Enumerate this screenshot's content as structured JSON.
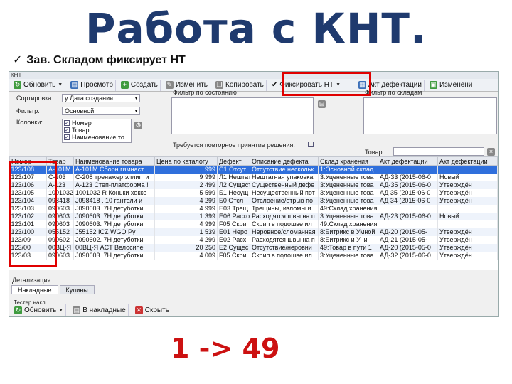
{
  "slide": {
    "title": "Работа с КНТ.",
    "bullet": "Зав. Складом фиксирует НТ",
    "counter": "1 -> 49"
  },
  "window": {
    "title": "КНТ"
  },
  "toolbar": {
    "refresh": "Обновить",
    "preview": "Просмотр",
    "create": "Создать",
    "edit": "Изменить",
    "copy": "Копировать",
    "fix": "Фиксировать НТ",
    "defect_act": "Акт дефектации",
    "changes": "Изменени"
  },
  "filters": {
    "sort_label": "Сортировка:",
    "sort_value": "у Дата создания",
    "phase_label": "Фильтр:",
    "phase_value": "Основной",
    "columns_label": "Колонки:",
    "columns": [
      "Номер",
      "Товар",
      "Наименование то"
    ],
    "state_filter_label": "Фильтр по состоянию",
    "warehouse_filter_label": "Фильтр по складам",
    "reaccept_label": "Требуется повторное принятие решения:",
    "goods_label": "Товар:"
  },
  "grid": {
    "columns": [
      "Номер",
      "Товар",
      "Наименование товара",
      "Цена по каталогу",
      "Дефект",
      "Описание дефекта",
      "Склад хранения",
      "Акт дефектации",
      "Акт дефектации"
    ],
    "rows": [
      [
        "123/108",
        "А-101М",
        "А-101М Сборн гимнаст",
        "999",
        "С1 Отсут",
        "Отсутствие нескольк",
        "1:Основной склад",
        "",
        ""
      ],
      [
        "123/107",
        "С-203",
        "С-208 тренажер эллипти",
        "9 999",
        "Л1 Нештат",
        "Нештатная упаковка",
        "3:Уцененные това",
        "АД-33 (2015-06-0",
        "Новый"
      ],
      [
        "123/106",
        "А-123",
        "А-123 Степ-платформа !",
        "2 499",
        "Л2 Сущест",
        "Существенный дефе",
        "3:Уцененные това",
        "АД-35 (2015-06-0",
        "Утверждён"
      ],
      [
        "123/105",
        "1001032",
        "1001032 R Коньки хокке",
        "5 599",
        "Б1 Несущ",
        "Несущественный пот",
        "3:Уцененные това",
        "АД 35 (2015-06-0",
        "Утверждён"
      ],
      [
        "123/104",
        "098418",
        "J098418 . 10 гантели и",
        "4 299",
        "Б0 Отсл",
        "Отслоение/отрыв по",
        "3:Уцененные това",
        "АД 34 (2015-06-0",
        "Утверждён"
      ],
      [
        "123/103",
        "090603",
        "J090603. 7Н детуботки",
        "4 999",
        "Е03 Трещ",
        "Трещины, изломы и",
        "49:Склад хранения",
        "",
        ""
      ],
      [
        "123/102",
        "090603",
        "J090603. 7Н детуботки",
        "1 399",
        "Е06 Расхо",
        "Расходятся швы на п",
        "3:Уцененные това",
        "АД-23 (2015-06-0",
        "Новый"
      ],
      [
        "123/101",
        "090603",
        "J090603. 7Н детуботки",
        "4 999",
        "F05 Скри",
        "Скрип в подошве ил",
        "49:Склад хранения",
        "",
        ""
      ],
      [
        "123/100",
        "055152",
        "J55152 ICZ WGQ Ру",
        "1 539",
        "E01 Неро",
        "Неровное/сломанная",
        "8:Битрикс в Умной",
        "АД-20 (2015-05-",
        "Утверждён"
      ],
      [
        "123/09",
        "090602",
        "J090602. 7Н детуботки",
        "4 299",
        "E02 Расх",
        "Расходятся швы на п",
        "8:Битрикс и Уни",
        "АД-21 (2015-05-",
        "Утверждён"
      ],
      [
        "123/00",
        "00ВЦ-Я",
        "00ВЦ-Я ACT Велосипе",
        "20 250",
        "Е2 Сущес",
        "Отсутствие/неровни",
        "49:Товар в пути 1",
        "АД-20 (2015-05-0",
        "Утверждён"
      ],
      [
        "123/03",
        "090603",
        "J090603. 7Н детуботки",
        "4 009",
        "F05 Скри",
        "Скрип в подошве ил",
        "3:Уцененные това",
        "АД-32 (2015-06-0",
        "Утверждён"
      ]
    ]
  },
  "details": {
    "section_label": "Детализация",
    "tabs": [
      "Накладные",
      "Кулины"
    ],
    "toolbar_label": "Тестер накл",
    "refresh": "Обновить",
    "to_invoice": "В накладные",
    "hide": "Скрыть"
  },
  "colors": {
    "title": "#1f3a6e",
    "highlight": "#e00000",
    "selected_row": "#2f6fdc"
  }
}
